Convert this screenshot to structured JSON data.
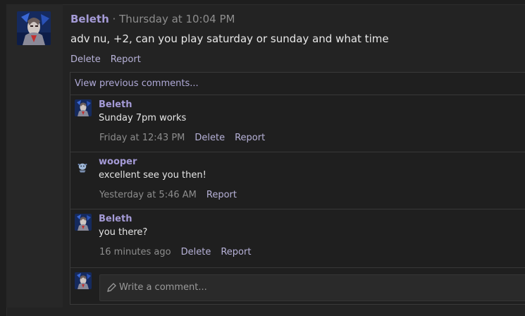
{
  "post": {
    "author": "Beleth",
    "separator": " · ",
    "time": "Thursday at 10:04 PM",
    "message": "adv nu, +2, can you play saturday or sunday and what time",
    "actions": [
      "Delete",
      "Report"
    ]
  },
  "comments_box": {
    "view_previous": "View previous comments...",
    "comments": [
      {
        "author": "Beleth",
        "text": "Sunday 7pm works",
        "time": "Friday at 12:43 PM",
        "actions": [
          "Delete",
          "Report"
        ],
        "avatar_icon": "beleth-avatar"
      },
      {
        "author": "wooper",
        "text": "excellent see you then!",
        "time": "Yesterday at 5:46 AM",
        "actions": [
          "Report"
        ],
        "avatar_icon": "wooper-avatar"
      },
      {
        "author": "Beleth",
        "text": "you there?",
        "time": "16 minutes ago",
        "actions": [
          "Delete",
          "Report"
        ],
        "avatar_icon": "beleth-avatar"
      }
    ],
    "compose_placeholder": "Write a comment..."
  },
  "colors": {
    "accent": "#a49ad6",
    "link": "#b7b2d8",
    "muted": "#8d8d8d",
    "background": "#232323"
  }
}
